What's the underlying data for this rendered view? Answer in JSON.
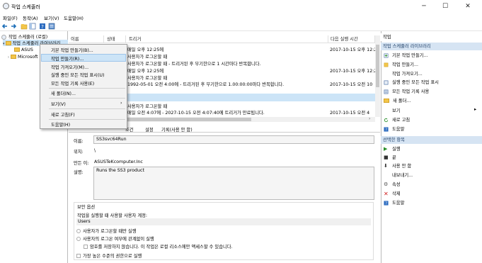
{
  "window": {
    "title": "작업 스케줄러",
    "minimize": "─",
    "maximize": "☐",
    "close": "✕"
  },
  "menu": [
    "파일(F)",
    "동작(A)",
    "보기(V)",
    "도움말(H)"
  ],
  "tree": {
    "root": "작업 스케줄러 (로컬)",
    "library": "작업 스케줄러 라이브러리",
    "asus": "ASUS",
    "microsoft": "Microsoft"
  },
  "columns": [
    "이름",
    "상태",
    "트리거",
    "다음 실행 시간"
  ],
  "rows": [
    {
      "trigger": "매일 오후 12:25에",
      "next": "2017-10-15 오후 12:2"
    },
    {
      "trigger": "사용자가 로그온할 때",
      "next": ""
    },
    {
      "trigger": "사용자가 로그온할 때 - 트리거된 후 무기한으로 1 시간마다 반복합니다.",
      "next": ""
    },
    {
      "trigger": "매일 오후 12:25에",
      "next": "2017-10-15 오후 12:2"
    },
    {
      "trigger": "사용자가 로그온할 때",
      "next": ""
    },
    {
      "trigger": "1992-05-01 오전 4:00에 - 트리거된 후 무기한으로 1.00:00:00마다 반복합니다.",
      "next": "2017-10-15 오전 10"
    },
    {
      "trigger": "사용자가 로그온할 때",
      "next": ""
    },
    {
      "trigger": "매일 오전 4:07에 - 2027-10-15 오전 4:07:40에 트리거가 만료됩니다.",
      "next": "2017-10-15 오전 4"
    }
  ],
  "tabs": [
    "조건",
    "설정",
    "기록(사용 안 함)"
  ],
  "detail": {
    "name_label": "이름:",
    "name_value": "SS3svc64Run",
    "location_label": "위치:",
    "location_value": "\\",
    "author_label": "만든 이:",
    "author_value": "ASUSTeKcomputer.Inc",
    "desc_label": "설명:",
    "desc_value": "Runs the SS3 product",
    "security_title": "보안 옵션",
    "account_prompt": "작업을 실행할 때 사용할 사용자 계정:",
    "account_value": "Users",
    "opt1": "사용자가 로그온할 때만 실행",
    "opt2": "사용자의 로그온 여부에 관계없이 실행",
    "opt3": "암호를 저장하지 않습니다. 이 작업은 로컬 리소스에만 액세스할 수 있습니다.",
    "opt4": "가장 높은 수준의 권한으로 실행"
  },
  "actions": {
    "header": "작업",
    "lib_header": "작업 스케줄러 라이브러리",
    "lib_items": [
      "기본 작업 만들기...",
      "작업 만들기...",
      "작업 가져오기...",
      "실행 중인 모든 작업 표시",
      "모든 작업 기록 사용",
      "새 폴더...",
      "보기",
      "새로 고침",
      "도움말"
    ],
    "sel_header": "선택한 항목",
    "sel_items": [
      "실행",
      "끝",
      "사용 안 함",
      "내보내기...",
      "속성",
      "삭제",
      "도움말"
    ]
  },
  "context_menu": [
    "기본 작업 만들기(B)...",
    "작업 만들기(R)...",
    "작업 가져오기(M)...",
    "실행 중인 모든 작업 표시(U)",
    "모든 작업 기록 사용(E)",
    "새 폴더(N)...",
    "보기(V)",
    "새로 고침(F)",
    "도움말(H)"
  ]
}
